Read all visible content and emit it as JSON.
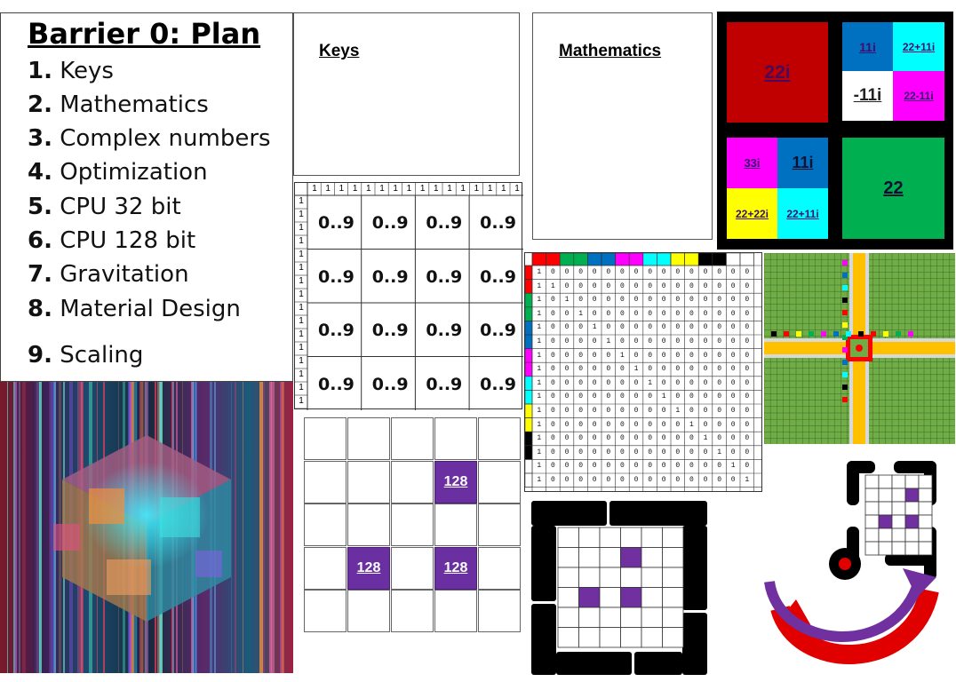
{
  "plan": {
    "title": "Barrier 0: Plan",
    "items": [
      {
        "num": "1.",
        "label": "Keys"
      },
      {
        "num": "2.",
        "label": "Mathematics"
      },
      {
        "num": "3.",
        "label": "Complex numbers"
      },
      {
        "num": "4.",
        "label": "Optimization"
      },
      {
        "num": "5.",
        "label": "CPU 32 bit"
      },
      {
        "num": "6.",
        "label": "CPU 128 bit"
      },
      {
        "num": "7.",
        "label": "Gravitation"
      },
      {
        "num": "8.",
        "label": "Material Design"
      },
      {
        "num": "9.",
        "label": "Scaling"
      }
    ]
  },
  "keys_panel": {
    "title": "Keys"
  },
  "math_panel": {
    "title": "Mathematics"
  },
  "complex_grid": {
    "big_red": "22i",
    "blue_1": "11i",
    "cyan_1": "22+11i",
    "white": "-11i",
    "magenta_1": "22-11i",
    "magenta_2": "33i",
    "blue_2": "11i",
    "yellow": "22+22i",
    "cyan_2": "22+11i",
    "green": "22",
    "colors": {
      "red": "#c00000",
      "blue": "#0070c0",
      "cyan": "#00ffff",
      "magenta": "#ff00ff",
      "yellow": "#ffff00",
      "green": "#00b050"
    }
  },
  "digit_grid": {
    "header_one": "1",
    "side_one": "1",
    "cell_text": "0..9"
  },
  "cpu128": {
    "label": "128",
    "purple": "#7030a0"
  },
  "bit_matrix": {
    "one": "1",
    "zero": "0"
  }
}
